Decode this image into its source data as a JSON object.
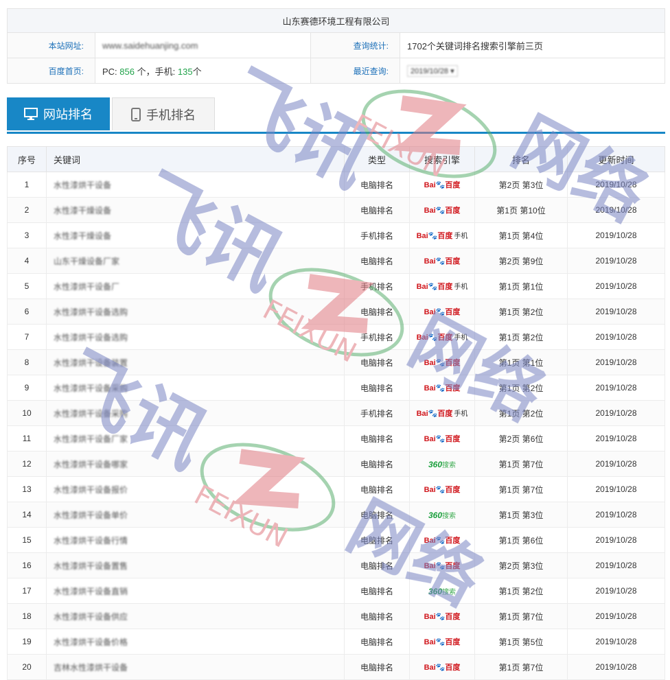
{
  "company": "山东赛德环境工程有限公司",
  "info": {
    "site_label": "本站网址:",
    "site_value": "www.saidehuanjing.com",
    "stats_label": "查询统计:",
    "stats_value": "1702个关键词排名搜索引擎前三页",
    "baidu_label": "百度首页:",
    "pc_prefix": "PC:",
    "pc_count": "856",
    "pc_unit": "个，手机:",
    "mobile_count": "135",
    "mobile_unit": "个",
    "recent_label": "最近查询:",
    "recent_date": "2019/10/28"
  },
  "tabs": {
    "website": "网站排名",
    "mobile": "手机排名"
  },
  "table": {
    "headers": [
      "序号",
      "关键词",
      "类型",
      "搜索引擎",
      "排名",
      "更新时间"
    ],
    "rows": [
      {
        "no": "1",
        "kw": "水性漆烘干设备",
        "type": "电脑排名",
        "engine": "baidu",
        "page": "2",
        "pos": "3",
        "date": "2019/10/28"
      },
      {
        "no": "2",
        "kw": "水性漆干燥设备",
        "type": "电脑排名",
        "engine": "baidu",
        "page": "1",
        "pos": "10",
        "date": "2019/10/28"
      },
      {
        "no": "3",
        "kw": "水性漆干燥设备",
        "type": "手机排名",
        "engine": "baidu-mobile",
        "page": "1",
        "pos": "4",
        "date": "2019/10/28"
      },
      {
        "no": "4",
        "kw": "山东干燥设备厂家",
        "type": "电脑排名",
        "engine": "baidu",
        "page": "2",
        "pos": "9",
        "date": "2019/10/28"
      },
      {
        "no": "5",
        "kw": "水性漆烘干设备厂",
        "type": "手机排名",
        "engine": "baidu-mobile",
        "page": "1",
        "pos": "1",
        "date": "2019/10/28"
      },
      {
        "no": "6",
        "kw": "水性漆烘干设备选购",
        "type": "电脑排名",
        "engine": "baidu",
        "page": "1",
        "pos": "2",
        "date": "2019/10/28"
      },
      {
        "no": "7",
        "kw": "水性漆烘干设备选购",
        "type": "手机排名",
        "engine": "baidu-mobile",
        "page": "1",
        "pos": "2",
        "date": "2019/10/28"
      },
      {
        "no": "8",
        "kw": "水性漆烘干设备装置",
        "type": "电脑排名",
        "engine": "baidu",
        "page": "1",
        "pos": "1",
        "date": "2019/10/28"
      },
      {
        "no": "9",
        "kw": "水性漆烘干设备采购",
        "type": "电脑排名",
        "engine": "baidu",
        "page": "1",
        "pos": "2",
        "date": "2019/10/28"
      },
      {
        "no": "10",
        "kw": "水性漆烘干设备采购",
        "type": "手机排名",
        "engine": "baidu-mobile",
        "page": "1",
        "pos": "2",
        "date": "2019/10/28"
      },
      {
        "no": "11",
        "kw": "水性漆烘干设备厂家",
        "type": "电脑排名",
        "engine": "baidu",
        "page": "2",
        "pos": "6",
        "date": "2019/10/28"
      },
      {
        "no": "12",
        "kw": "水性漆烘干设备哪家",
        "type": "电脑排名",
        "engine": "360",
        "page": "1",
        "pos": "7",
        "date": "2019/10/28"
      },
      {
        "no": "13",
        "kw": "水性漆烘干设备报价",
        "type": "电脑排名",
        "engine": "baidu",
        "page": "1",
        "pos": "7",
        "date": "2019/10/28"
      },
      {
        "no": "14",
        "kw": "水性漆烘干设备单价",
        "type": "电脑排名",
        "engine": "360",
        "page": "1",
        "pos": "3",
        "date": "2019/10/28"
      },
      {
        "no": "15",
        "kw": "水性漆烘干设备行情",
        "type": "电脑排名",
        "engine": "baidu",
        "page": "1",
        "pos": "6",
        "date": "2019/10/28"
      },
      {
        "no": "16",
        "kw": "水性漆烘干设备置售",
        "type": "电脑排名",
        "engine": "baidu",
        "page": "2",
        "pos": "3",
        "date": "2019/10/28"
      },
      {
        "no": "17",
        "kw": "水性漆烘干设备直销",
        "type": "电脑排名",
        "engine": "360",
        "page": "1",
        "pos": "2",
        "date": "2019/10/28"
      },
      {
        "no": "18",
        "kw": "水性漆烘干设备供应",
        "type": "电脑排名",
        "engine": "baidu",
        "page": "1",
        "pos": "7",
        "date": "2019/10/28"
      },
      {
        "no": "19",
        "kw": "水性漆烘干设备价格",
        "type": "电脑排名",
        "engine": "baidu",
        "page": "1",
        "pos": "5",
        "date": "2019/10/28"
      },
      {
        "no": "20",
        "kw": "吉林水性漆烘干设备",
        "type": "电脑排名",
        "engine": "baidu",
        "page": "1",
        "pos": "7",
        "date": "2019/10/28"
      }
    ]
  },
  "engines": {
    "baidu_a": "Bai",
    "baidu_b": "百度",
    "baidu_mobile": "手机",
    "s360_a": "360",
    "s360_b": "搜索"
  },
  "rank_text": {
    "di": "第",
    "ye": "页",
    "wei": "位"
  },
  "watermark": {
    "brand_cn_1": "飞讯",
    "brand_cn_2": "网络",
    "brand_en": "FEIXUN"
  },
  "colors": {
    "accent": "#1887c6",
    "green": "#22a34b",
    "red": "#d0161c"
  }
}
